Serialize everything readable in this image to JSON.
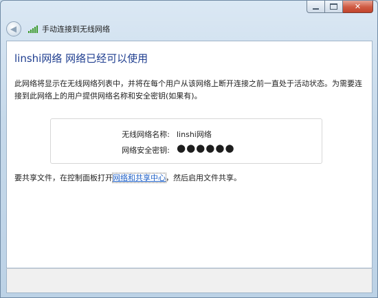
{
  "window": {
    "title": "手动连接到无线网络"
  },
  "caption": {
    "close": "✕"
  },
  "nav": {
    "back_icon": "back-arrow-icon",
    "network_icon": "wifi-signal-icon"
  },
  "main": {
    "heading": "linshi网络 网络已经可以使用",
    "description": "此网络将显示在无线网络列表中，并将在每个用户从该网络上断开连接之前一直处于活动状态。为需要连接到此网络上的用户提供网络名称和安全密钥(如果有)。",
    "info": {
      "ssid_label": "无线网络名称:",
      "ssid_value": "linshi网络",
      "key_label": "网络安全密钥:",
      "key_value": "●●●●●●"
    },
    "share": {
      "prefix": "要共享文件，在控制面板打开",
      "link": "网络和共享中心",
      "suffix": "，然后启用文件共享。"
    }
  },
  "colors": {
    "heading": "#1e3d8f",
    "link": "#1d5fc7",
    "close_button": "#cf5a42",
    "signal": "#3c9a2a"
  }
}
